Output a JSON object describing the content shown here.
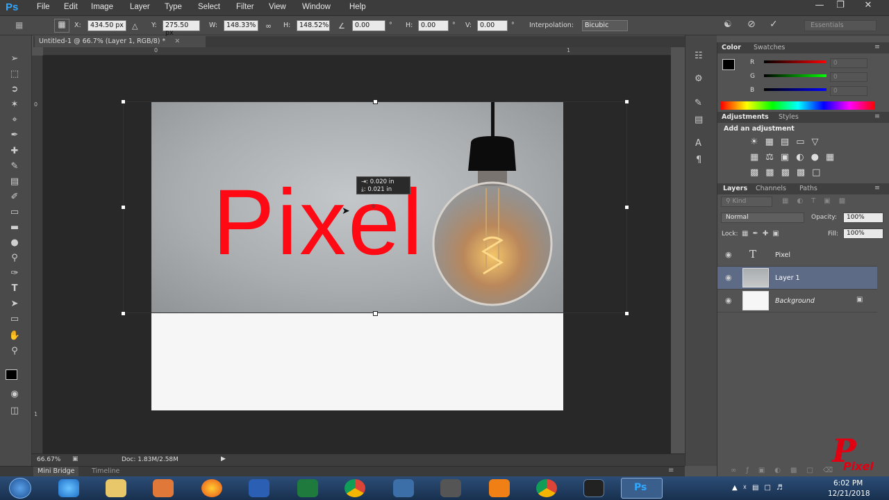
{
  "app": {
    "logo": "Ps",
    "menu": [
      "File",
      "Edit",
      "Image",
      "Layer",
      "Type",
      "Select",
      "Filter",
      "View",
      "Window",
      "Help"
    ]
  },
  "options": {
    "x_label": "X:",
    "x": "434.50 px",
    "y_label": "Y:",
    "y": "275.50 px",
    "w_label": "W:",
    "w": "148.33%",
    "h_label": "H:",
    "h": "148.52%",
    "angle": "0.00",
    "deg": "°",
    "hskew_label": "H:",
    "hskew": "0.00",
    "vskew_label": "V:",
    "vskew": "0.00",
    "interp_label": "Interpolation:",
    "interp": "Bicubic",
    "workspace": "Essentials"
  },
  "document": {
    "tab": "Untitled-1 @ 66.7% (Layer 1, RGB/8) *",
    "text": "Pixel",
    "ruler_top": [
      "0",
      "1"
    ],
    "ruler_left": [
      "0",
      "1"
    ],
    "tooltip_w": "0.020 in",
    "tooltip_h": "0.021 in"
  },
  "status": {
    "zoom": "66.67%",
    "doc": "Doc: 1.83M/2.58M"
  },
  "bottom_tabs": [
    "Mini Bridge",
    "Timeline"
  ],
  "color_panel": {
    "tabs": [
      "Color",
      "Swatches"
    ],
    "r": "R",
    "g": "G",
    "b": "B",
    "r_val": "0",
    "g_val": "0",
    "b_val": "0",
    "fg": "#000000",
    "bg": "#1a9e6b"
  },
  "adjustments": {
    "tabs": [
      "Adjustments",
      "Styles"
    ],
    "title": "Add an adjustment"
  },
  "layers": {
    "tabs": [
      "Layers",
      "Channels",
      "Paths"
    ],
    "kind": "Kind",
    "blend": "Normal",
    "opacity_label": "Opacity:",
    "opacity": "100%",
    "lock_label": "Lock:",
    "fill_label": "Fill:",
    "fill": "100%",
    "items": [
      {
        "name": "Pixel",
        "selected": false
      },
      {
        "name": "Layer 1",
        "selected": true
      },
      {
        "name": "Background",
        "selected": false
      }
    ]
  },
  "taskbar": {
    "time": "6:02 PM",
    "date": "12/21/2018"
  },
  "watermark": "Pixel"
}
